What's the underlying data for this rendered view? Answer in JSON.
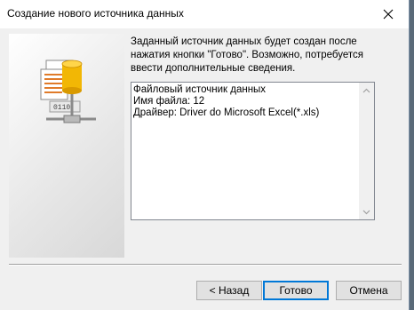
{
  "window": {
    "title": "Создание нового источника данных",
    "close_icon": "close-icon"
  },
  "intro": {
    "line1": "Заданный источник данных будет создан после",
    "line2": "нажатия кнопки \"Готово\". Возможно, потребуется",
    "line3": "ввести дополнительные сведения."
  },
  "summary": {
    "line1": "Файловый источник данных",
    "line2": "Имя файла:  12",
    "line3": "Драйвер:  Driver do Microsoft Excel(*.xls)"
  },
  "buttons": {
    "back": "< Назад",
    "finish": "Готово",
    "cancel": "Отмена"
  },
  "colors": {
    "accent": "#0078d7",
    "database": "#f2b705"
  }
}
